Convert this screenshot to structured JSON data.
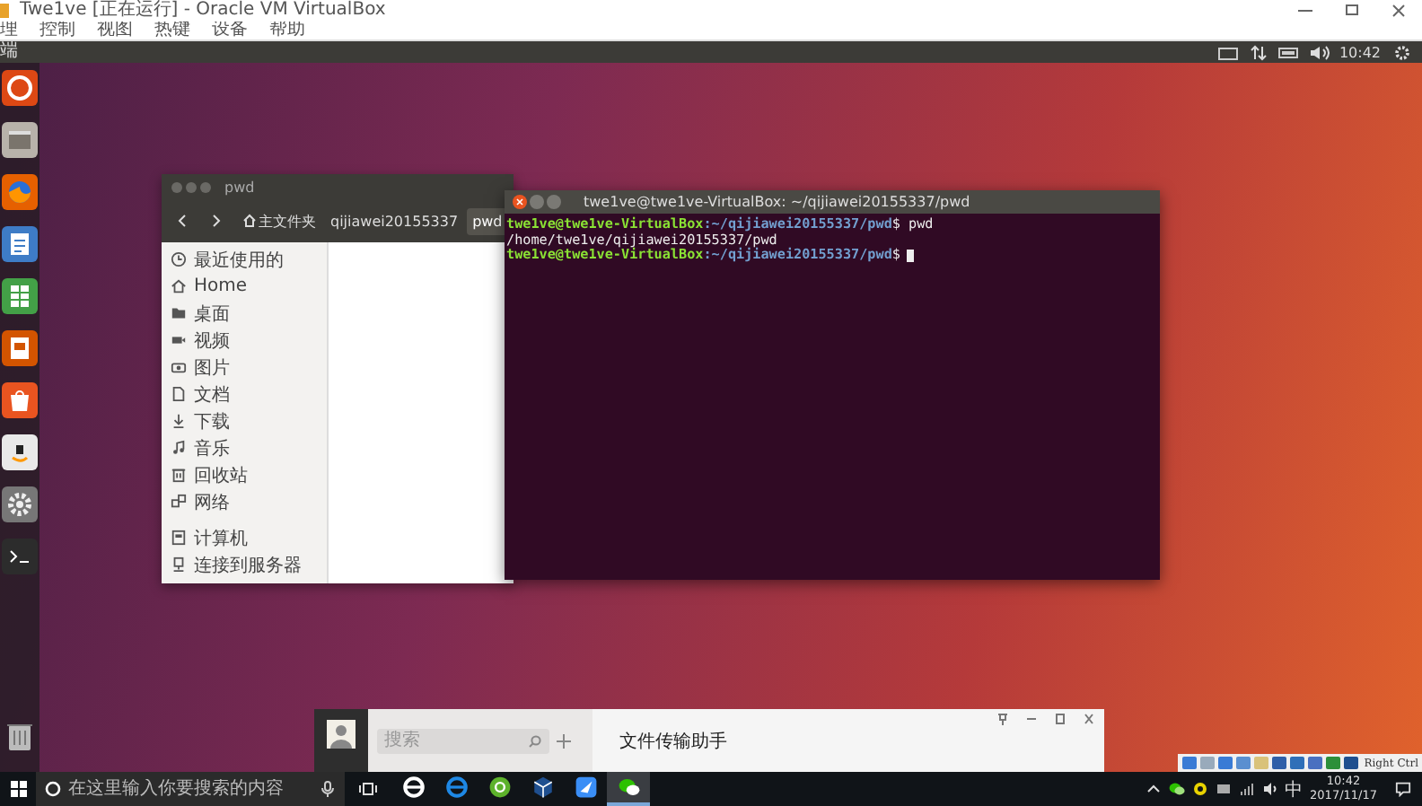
{
  "vbox_window": {
    "title": "Twe1ve [正在运行] - Oracle VM VirtualBox",
    "menu": [
      "理",
      "控制",
      "视图",
      "热键",
      "设备",
      "帮助"
    ]
  },
  "top_bar": {
    "app_name": "端",
    "time": "10:42"
  },
  "file_manager": {
    "title": "pwd",
    "path": [
      {
        "label": "主文件夹",
        "selected": false
      },
      {
        "label": "qijiawei20155337",
        "selected": false
      },
      {
        "label": "pwd",
        "selected": true
      }
    ],
    "places": [
      "最近使用的",
      "Home",
      "桌面",
      "视频",
      "图片",
      "文档",
      "下载",
      "音乐",
      "回收站",
      "网络"
    ],
    "devices": [
      "计算机",
      "连接到服务器"
    ]
  },
  "terminal": {
    "title": "twe1ve@twe1ve-VirtualBox: ~/qijiawei20155337/pwd",
    "lines": [
      {
        "kind": "prompt",
        "user": "twe1ve@twe1ve-VirtualBox",
        "path": ":~/qijiawei20155337/pwd",
        "command": "$ pwd",
        "cursor": false
      },
      {
        "kind": "output",
        "text": "/home/twe1ve/qijiawei20155337/pwd"
      },
      {
        "kind": "prompt",
        "user": "twe1ve@twe1ve-VirtualBox",
        "path": ":~/qijiawei20155337/pwd",
        "command": "$",
        "cursor": true
      }
    ]
  },
  "wechat": {
    "search_placeholder": "搜索",
    "chat_title": "文件传输助手"
  },
  "taskbar": {
    "search_placeholder": "在这里输入你要搜索的内容",
    "apps": [
      {
        "selected": false
      },
      {
        "selected": false
      },
      {
        "selected": false
      },
      {
        "selected": false
      },
      {
        "selected": false
      },
      {
        "selected": true
      }
    ],
    "tray": {
      "ime": "中",
      "time": "10:42",
      "date": "2017/11/17"
    }
  },
  "vm_status": {
    "host_key": "Right Ctrl"
  }
}
